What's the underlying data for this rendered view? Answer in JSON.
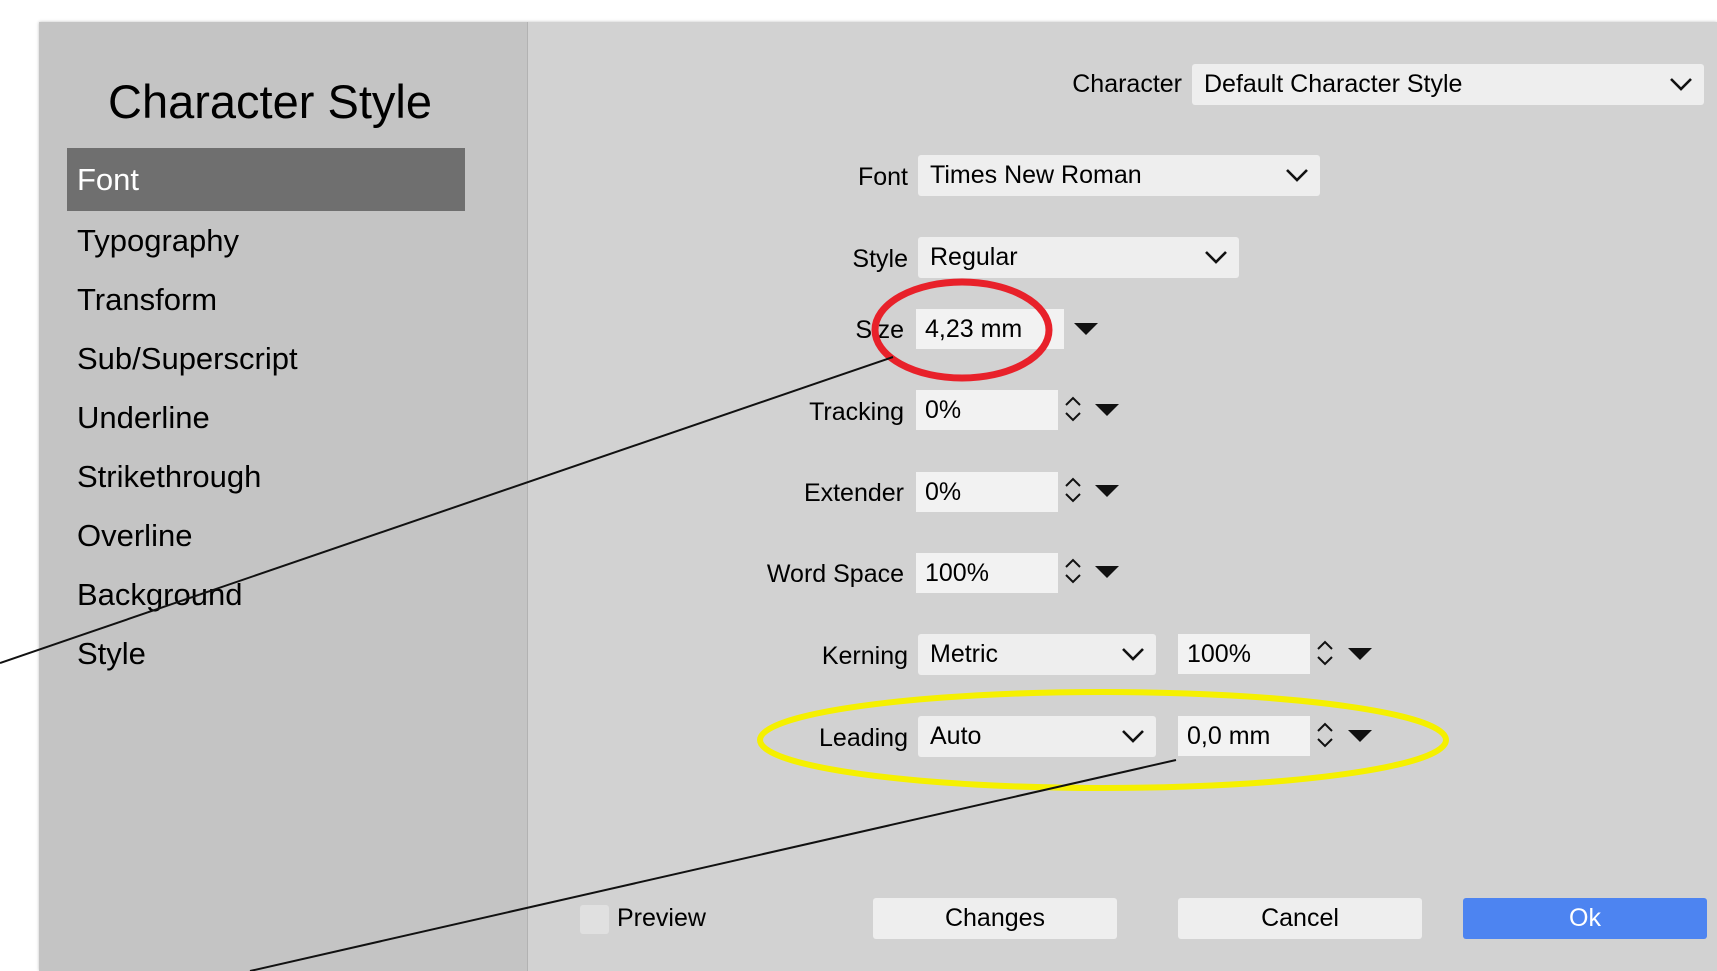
{
  "sidebar": {
    "title": "Character Style",
    "items": [
      {
        "label": "Font",
        "selected": true
      },
      {
        "label": "Typography"
      },
      {
        "label": "Transform"
      },
      {
        "label": "Sub/Superscript"
      },
      {
        "label": "Underline"
      },
      {
        "label": "Strikethrough"
      },
      {
        "label": "Overline"
      },
      {
        "label": "Background"
      },
      {
        "label": "Style"
      }
    ]
  },
  "form": {
    "character": {
      "label": "Character",
      "value": "Default Character Style"
    },
    "font": {
      "label": "Font",
      "value": "Times New Roman"
    },
    "style": {
      "label": "Style",
      "value": "Regular"
    },
    "size": {
      "label": "Size",
      "value": "4,23 mm"
    },
    "tracking": {
      "label": "Tracking",
      "value": "0%"
    },
    "extender": {
      "label": "Extender",
      "value": "0%"
    },
    "word_space": {
      "label": "Word Space",
      "value": "100%"
    },
    "kerning": {
      "label": "Kerning",
      "value": "Metric",
      "amount": "100%"
    },
    "leading": {
      "label": "Leading",
      "value": "Auto",
      "amount": "0,0 mm"
    }
  },
  "footer": {
    "preview_label": "Preview",
    "changes_label": "Changes",
    "cancel_label": "Cancel",
    "ok_label": "Ok"
  },
  "colors": {
    "sidebar_bg": "#c4c4c4",
    "panel_bg": "#d2d2d2",
    "selected_item": "#6f6f6f",
    "primary_button": "#4d84f1",
    "annotation_red": "#e8212a",
    "annotation_yellow": "#f5f000"
  }
}
